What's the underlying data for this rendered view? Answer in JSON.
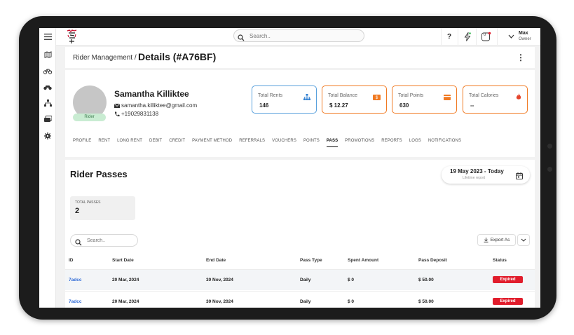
{
  "topbar": {
    "search_placeholder": "Search..",
    "help_label": "?",
    "notification_count": "0",
    "user_name": "Max",
    "user_role": "Owner"
  },
  "header": {
    "breadcrumb": "Rider Management /",
    "title": "Details (#A76BF)"
  },
  "profile": {
    "name": "Samantha Killiktee",
    "email": "samantha.killiktee@gmail.com",
    "phone": "+19029831138",
    "badge": "Rider"
  },
  "stats": [
    {
      "label": "Total Rents",
      "value": "146",
      "color": "#58a0dc"
    },
    {
      "label": "Total Balance",
      "value": "$ 12.27",
      "color": "#f07a23"
    },
    {
      "label": "Total Points",
      "value": "630",
      "color": "#f07a23"
    },
    {
      "label": "Total Calories",
      "value": "--",
      "color": "#f07a23"
    }
  ],
  "tabs": [
    "PROFILE",
    "RENT",
    "LONG RENT",
    "DEBIT",
    "CREDIT",
    "PAYMENT METHOD",
    "REFERRALS",
    "VOUCHERS",
    "POINTS",
    "PASS",
    "PROMOTIONS",
    "REPORTS",
    "LOGS",
    "NOTIFICATIONS"
  ],
  "active_tab": "PASS",
  "passes": {
    "title": "Rider Passes",
    "date_range": "19 May 2023 - Today",
    "date_sub": "Lifetime report",
    "total_label": "TOTAL PASSES",
    "total_value": "2",
    "search_placeholder": "Search..",
    "export_label": "Export As",
    "columns": [
      "ID",
      "Start Date",
      "End Date",
      "Pass Type",
      "Spent Amount",
      "Pass Deposit",
      "Status"
    ],
    "rows": [
      [
        "7adcc",
        "20 Mar, 2024",
        "30 Nov, 2024",
        "Daily",
        "$ 0",
        "$ 50.00",
        "Expired"
      ],
      [
        "7adcc",
        "20 Mar, 2024",
        "30 Nov, 2024",
        "Daily",
        "$ 0",
        "$ 50.00",
        "Expired"
      ]
    ]
  },
  "colors": {
    "accent_red": "#e11d2c",
    "link_blue": "#2c68d6",
    "rider_badge": "#c9ecd2"
  }
}
